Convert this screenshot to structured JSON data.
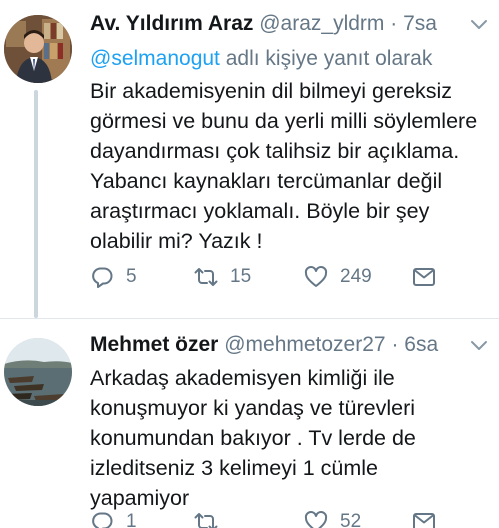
{
  "tweets": [
    {
      "author_name": "Av. Yıldırım Araz",
      "handle": "@araz_yldrm",
      "separator": "·",
      "time": "7sa",
      "reply_to": {
        "mention": "@selmanogut",
        "suffix": " adlı kişiye yanıt olarak"
      },
      "text": "Bir akademisyenin dil bilmeyi gereksiz\ngörmesi ve bunu da yerli milli söylemlere\ndayandırması çok talihsiz bir açıklama.\nYabancı kaynakları tercümanlar değil\naraştırmacı yoklamalı. Böyle bir şey\nolabilir mi? Yazık !",
      "replies": "5",
      "retweets": "15",
      "likes": "249"
    },
    {
      "author_name": "Mehmet özer",
      "handle": "@mehmetozer27",
      "separator": "·",
      "time": "6sa",
      "text": "Arkadaş akademisyen kimliği ile\nkonuşmuyor ki yandaş ve türevleri\nkonumundan bakıyor . Tv lerde de\nizleditseniz 3 kelimeyi 1 cümle\nyapamiyor",
      "replies": "1",
      "retweets": "",
      "likes": "52"
    }
  ],
  "icons": {
    "reply": "reply-icon",
    "retweet": "retweet-icon",
    "like": "heart-icon",
    "dm": "envelope-icon",
    "more": "chevron-down-icon"
  },
  "colors": {
    "link": "#1da1f2",
    "secondary": "#657786",
    "text": "#14171a",
    "divider": "#e1e8ed",
    "thread_line": "#ccd6dd"
  }
}
